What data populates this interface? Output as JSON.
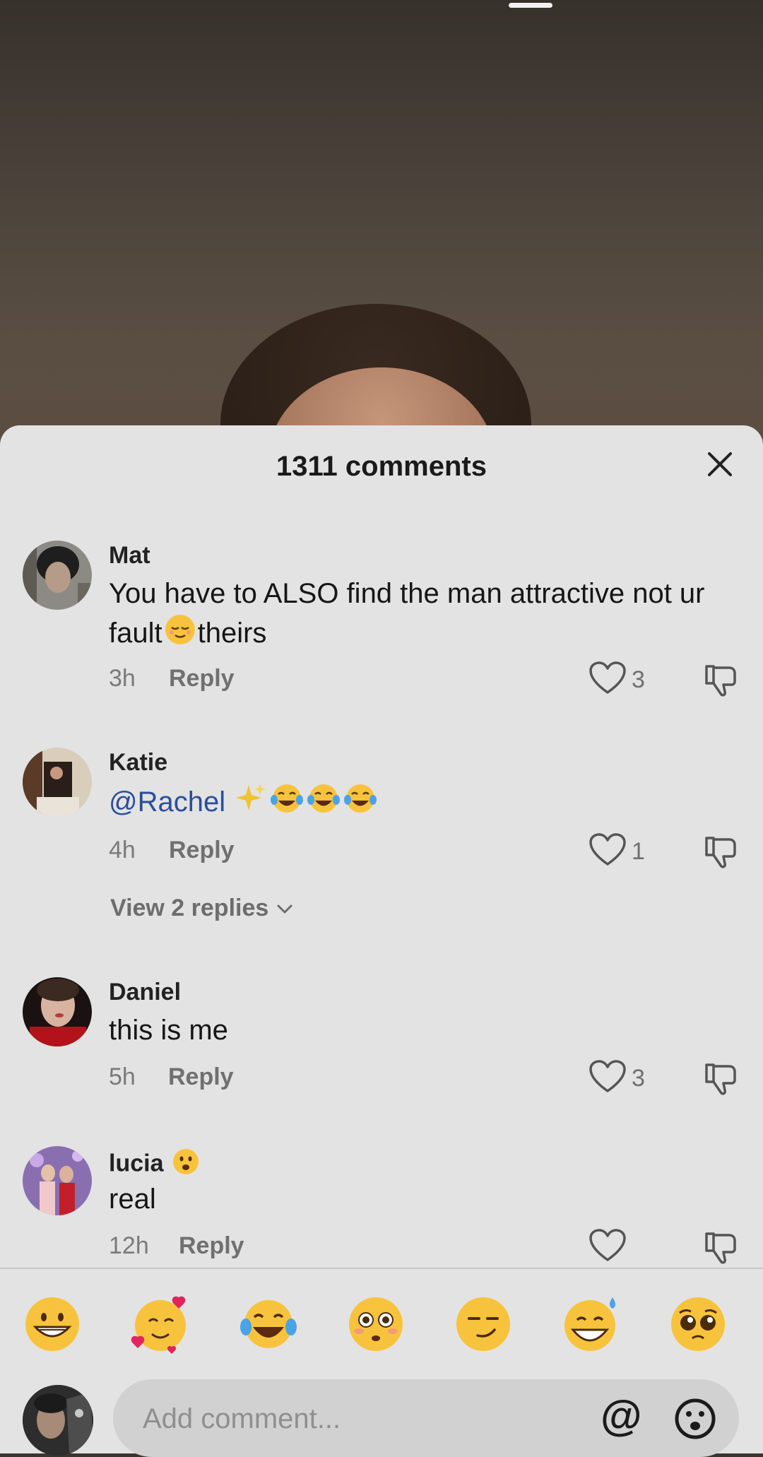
{
  "sheet": {
    "title": "1311 comments"
  },
  "comments": [
    {
      "username": "Mat",
      "text_before_emoji": "You have to ALSO find the man attractive not ur fault",
      "text_after_emoji": "theirs",
      "inline_emoji": "relieved-face",
      "time": "3h",
      "reply_label": "Reply",
      "likes": "3"
    },
    {
      "username": "Katie",
      "mention": "@Rachel",
      "emojis": [
        "sparkles",
        "tears-of-joy",
        "tears-of-joy",
        "tears-of-joy"
      ],
      "time": "4h",
      "reply_label": "Reply",
      "likes": "1",
      "view_replies": "View 2 replies"
    },
    {
      "username": "Daniel",
      "text": "this is me",
      "time": "5h",
      "reply_label": "Reply",
      "likes": "3"
    },
    {
      "username": "lucia",
      "username_emoji": "frowning-open-mouth",
      "text": "real",
      "time": "12h",
      "reply_label": "Reply",
      "likes": ""
    }
  ],
  "emoji_bar": [
    "grinning-face",
    "smiling-hearts",
    "tears-of-joy",
    "flushed-face",
    "smirk",
    "sweat-smile",
    "pleading-face"
  ],
  "composer": {
    "placeholder": "Add comment...",
    "mention_label": "@"
  },
  "colors": {
    "sheet_bg": "#e3e3e3",
    "mention": "#2a4f9a",
    "secondary_text": "#707070"
  }
}
